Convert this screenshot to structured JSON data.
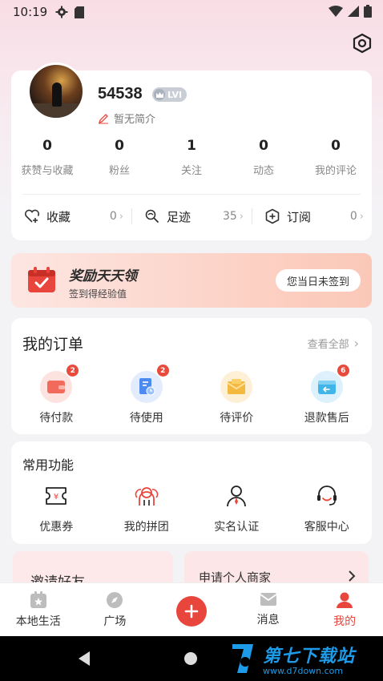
{
  "status_bar": {
    "time": "10:19"
  },
  "profile": {
    "username": "54538",
    "level": "LVI",
    "bio": "暂无简介",
    "stats": [
      {
        "value": "0",
        "label": "获赞与收藏"
      },
      {
        "value": "0",
        "label": "粉丝"
      },
      {
        "value": "1",
        "label": "关注"
      },
      {
        "value": "0",
        "label": "动态"
      },
      {
        "value": "0",
        "label": "我的评论"
      }
    ],
    "quick_links": [
      {
        "label": "收藏",
        "count": "0",
        "icon": "heart-plus-icon"
      },
      {
        "label": "足迹",
        "count": "35",
        "icon": "footprint-icon"
      },
      {
        "label": "订阅",
        "count": "0",
        "icon": "subscribe-icon"
      }
    ]
  },
  "reward": {
    "title": "奖励天天领",
    "subtitle": "签到得经验值",
    "button": "您当日未签到"
  },
  "orders": {
    "title": "我的订单",
    "view_all": "查看全部",
    "items": [
      {
        "label": "待付款",
        "badge": "2",
        "icon": "wallet-icon",
        "color": "#f26a5b"
      },
      {
        "label": "待使用",
        "badge": "2",
        "icon": "ticket-clock-icon",
        "color": "#4b8af0"
      },
      {
        "label": "待评价",
        "badge": "",
        "icon": "envelope-icon",
        "color": "#f4b940"
      },
      {
        "label": "退款售后",
        "badge": "6",
        "icon": "refund-icon",
        "color": "#3fb5ea"
      }
    ]
  },
  "functions": {
    "title": "常用功能",
    "items": [
      {
        "label": "优惠券",
        "icon": "coupon-icon"
      },
      {
        "label": "我的拼团",
        "icon": "group-buy-icon"
      },
      {
        "label": "实名认证",
        "icon": "verify-user-icon"
      },
      {
        "label": "客服中心",
        "icon": "headset-icon"
      }
    ]
  },
  "promos": {
    "left": "邀请好友",
    "right": "申请个人商家"
  },
  "tabbar": {
    "items": [
      {
        "label": "本地生活",
        "icon": "local-life-icon"
      },
      {
        "label": "广场",
        "icon": "compass-icon"
      },
      {
        "label": "",
        "icon": "plus-icon"
      },
      {
        "label": "消息",
        "icon": "mail-icon"
      },
      {
        "label": "我的",
        "icon": "person-icon"
      }
    ],
    "active": "我的"
  },
  "watermark": {
    "text": "第七下载站",
    "url_text": "www.d7down.com"
  },
  "colors": {
    "accent": "#e8453c",
    "reward_bg": "#fcd3c7",
    "badge": "#e84a3c"
  }
}
